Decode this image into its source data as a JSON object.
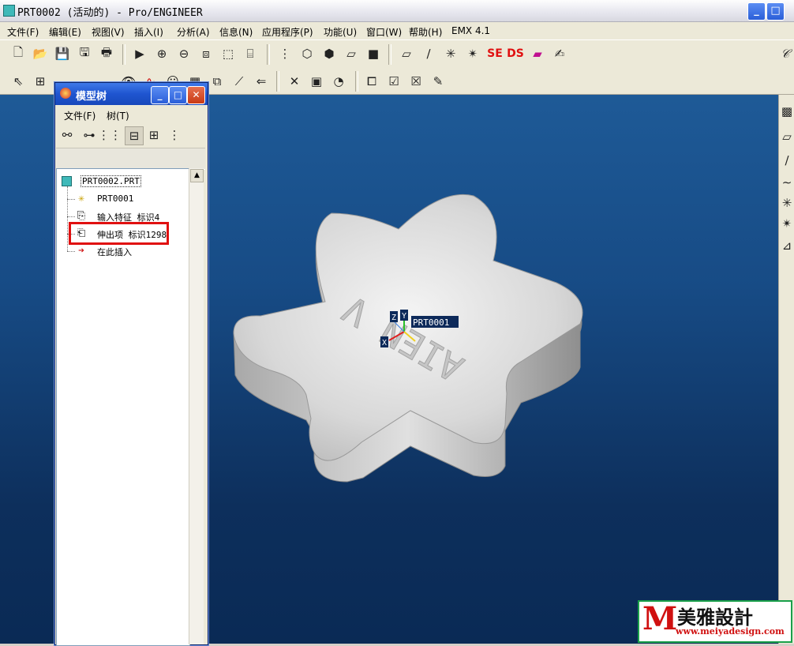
{
  "window": {
    "title": "PRT0002 (活动的) - Pro/ENGINEER"
  },
  "menu": [
    "文件(F)",
    "编辑(E)",
    "视图(V)",
    "插入(I)",
    "分析(A)",
    "信息(N)",
    "应用程序(P)",
    "功能(U)",
    "窗口(W)",
    "帮助(H)",
    "EMX 4.1"
  ],
  "toolbar": {
    "se_label": "SE",
    "ds_label": "DS"
  },
  "model_tree": {
    "title": "模型树",
    "menu": [
      "文件(F)",
      "树(T)"
    ],
    "nodes": [
      {
        "label": "PRT0002.PRT",
        "icon": "part-icon"
      },
      {
        "label": "PRT0001",
        "icon": "csys-icon"
      },
      {
        "label": "输入特征 标识4",
        "icon": "import-feature-icon"
      },
      {
        "label": "伸出项 标识1298",
        "icon": "protrusion-icon",
        "highlighted": true
      },
      {
        "label": "在此插入",
        "icon": "insert-here-arrow-icon"
      }
    ]
  },
  "viewport": {
    "csys_label": "PRT0001",
    "axes": [
      "Z",
      "Y",
      "X"
    ],
    "embossed_text": "AIEN V"
  },
  "watermark": {
    "brand": "美雅設計",
    "url": "www.meiyadesign.com",
    "logo_letter": "M"
  },
  "colors": {
    "highlight_box": "#e01010",
    "viewport_top": "#1e5a97",
    "viewport_bottom": "#0a2a55",
    "tree_title": "#1f55d0"
  }
}
